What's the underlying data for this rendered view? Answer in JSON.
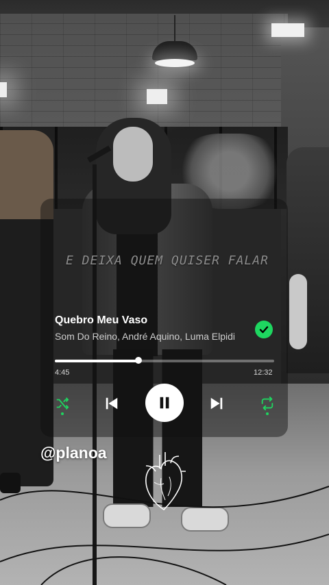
{
  "lyric": "E DEIXA QUEM QUISER FALAR",
  "player": {
    "title": "Quebro Meu Vaso",
    "artist": "Som Do Reino, André Aquino, Luma Elpidio",
    "liked": true,
    "elapsed": "4:45",
    "duration": "12:32",
    "progress_fraction": 0.38,
    "state": "playing",
    "shuffle_on": true,
    "repeat_on": true
  },
  "handle": "@planoa",
  "icons": {
    "liked": "check-circle-icon",
    "shuffle": "shuffle-icon",
    "previous": "skip-previous-icon",
    "pause": "pause-icon",
    "next": "skip-next-icon",
    "repeat": "repeat-icon",
    "sticker": "anatomical-heart-icon"
  },
  "colors": {
    "accent": "#1ed760",
    "play_button": "#ffffff"
  }
}
